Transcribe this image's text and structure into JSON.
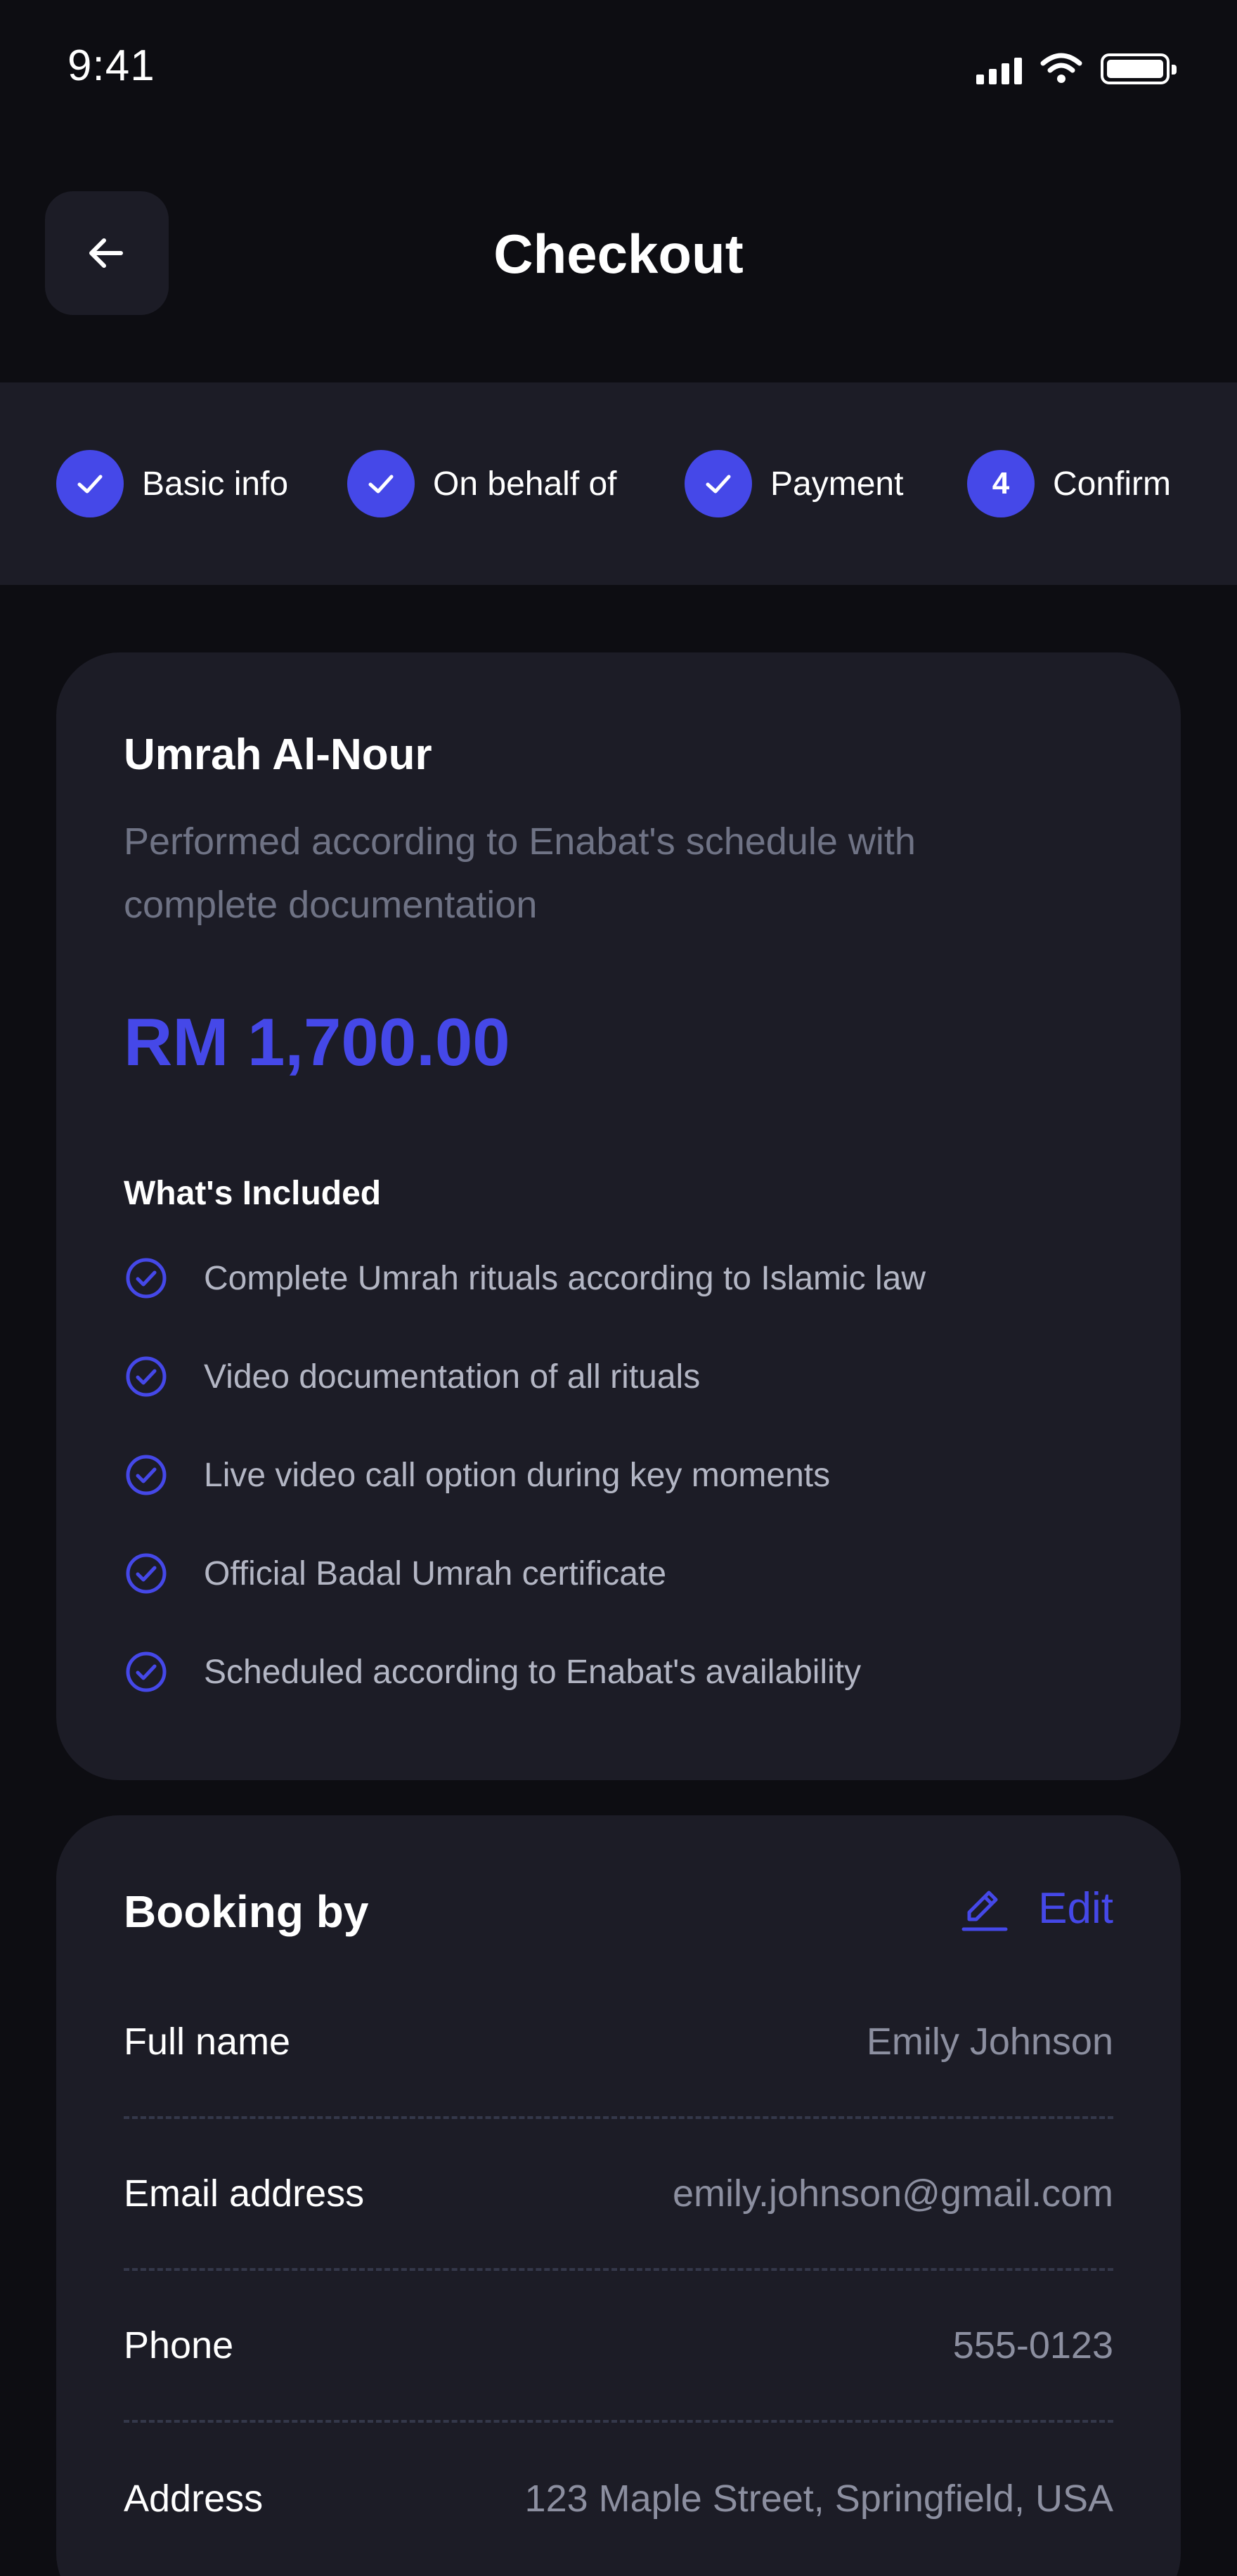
{
  "status_bar": {
    "time": "9:41"
  },
  "header": {
    "title": "Checkout"
  },
  "stepper": {
    "steps": [
      {
        "label": "Basic info",
        "state": "done"
      },
      {
        "label": "On behalf of",
        "state": "done"
      },
      {
        "label": "Payment",
        "state": "done"
      },
      {
        "label": "Confirm",
        "state": "current",
        "number": "4"
      }
    ]
  },
  "package": {
    "title": "Umrah Al-Nour",
    "description": "Performed according to Enabat's schedule with complete documentation",
    "price": "RM 1,700.00",
    "included_title": "What's Included",
    "included": [
      "Complete Umrah rituals according to Islamic law",
      "Video documentation of all rituals",
      "Live video call option during key moments",
      "Official Badal Umrah certificate",
      "Scheduled according to Enabat's availability"
    ]
  },
  "booking": {
    "title": "Booking by",
    "edit_label": "Edit",
    "rows": [
      {
        "label": "Full name",
        "value": "Emily Johnson"
      },
      {
        "label": "Email address",
        "value": "emily.johnson@gmail.com"
      },
      {
        "label": "Phone",
        "value": "555-0123"
      },
      {
        "label": "Address",
        "value": "123 Maple Street, Springfield, USA"
      }
    ]
  },
  "colors": {
    "background": "#0d0d12",
    "surface": "#1c1c26",
    "accent": "#4548e8",
    "muted_text": "#6f7385"
  },
  "icons": {
    "back": "arrow-left-icon",
    "step_done": "check-icon",
    "included": "check-circle-icon",
    "edit": "pencil-icon"
  }
}
